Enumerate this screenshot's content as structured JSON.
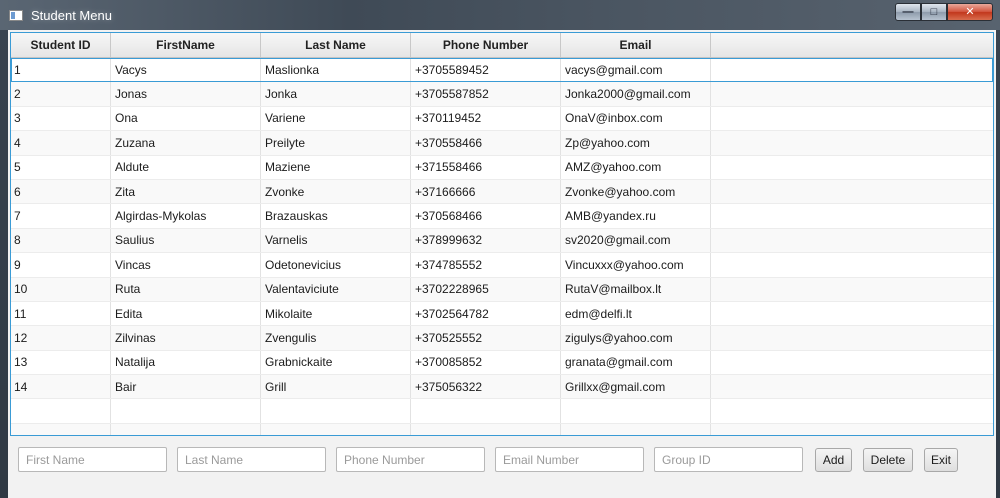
{
  "window": {
    "title": "Student Menu"
  },
  "table": {
    "columns": [
      "Student ID",
      "FirstName",
      "Last Name",
      "Phone Number",
      "Email"
    ],
    "rows": [
      [
        "1",
        "Vacys",
        "Maslionka",
        "+3705589452",
        "vacys@gmail.com"
      ],
      [
        "2",
        "Jonas",
        "Jonka",
        "+3705587852",
        "Jonka2000@gmail.com"
      ],
      [
        "3",
        "Ona",
        "Variene",
        "+370119452",
        "OnaV@inbox.com"
      ],
      [
        "4",
        "Zuzana",
        "Preilyte",
        "+370558466",
        "Zp@yahoo.com"
      ],
      [
        "5",
        "Aldute",
        "Maziene",
        "+371558466",
        "AMZ@yahoo.com"
      ],
      [
        "6",
        "Zita",
        "Zvonke",
        "+37166666",
        "Zvonke@yahoo.com"
      ],
      [
        "7",
        "Algirdas-Mykolas",
        "Brazauskas",
        "+370568466",
        "AMB@yandex.ru"
      ],
      [
        "8",
        "Saulius",
        "Varnelis",
        "+378999632",
        "sv2020@gmail.com"
      ],
      [
        "9",
        "Vincas",
        "Odetonevicius",
        "+374785552",
        "Vincuxxx@yahoo.com"
      ],
      [
        "10",
        "Ruta",
        "Valentaviciute",
        "+3702228965",
        "RutaV@mailbox.lt"
      ],
      [
        "11",
        "Edita",
        "Mikolaite",
        "+3702564782",
        "edm@delfi.lt"
      ],
      [
        "12",
        "Zilvinas",
        "Zvengulis",
        "+370525552",
        "zigulys@yahoo.com"
      ],
      [
        "13",
        "Natalija",
        "Grabnickaite",
        "+370085852",
        "granata@gmail.com"
      ],
      [
        "14",
        "Bair",
        "Grill",
        "+375056322",
        "Grillxx@gmail.com"
      ]
    ]
  },
  "form": {
    "first_name_placeholder": "First Name",
    "last_name_placeholder": "Last Name",
    "phone_placeholder": "Phone Number",
    "email_placeholder": "Email Number",
    "group_placeholder": "Group ID",
    "first_name_value": "",
    "last_name_value": "",
    "phone_value": "",
    "email_value": "",
    "group_value": "",
    "add_label": "Add",
    "delete_label": "Delete",
    "exit_label": "Exit"
  },
  "colors": {
    "accent": "#3a9bd5",
    "titlebar": "#3f4a56",
    "close_button": "#c2371c"
  },
  "icons": {
    "window": "app-window-icon",
    "minimize": "minimize-icon",
    "maximize": "maximize-icon",
    "close": "close-icon"
  }
}
